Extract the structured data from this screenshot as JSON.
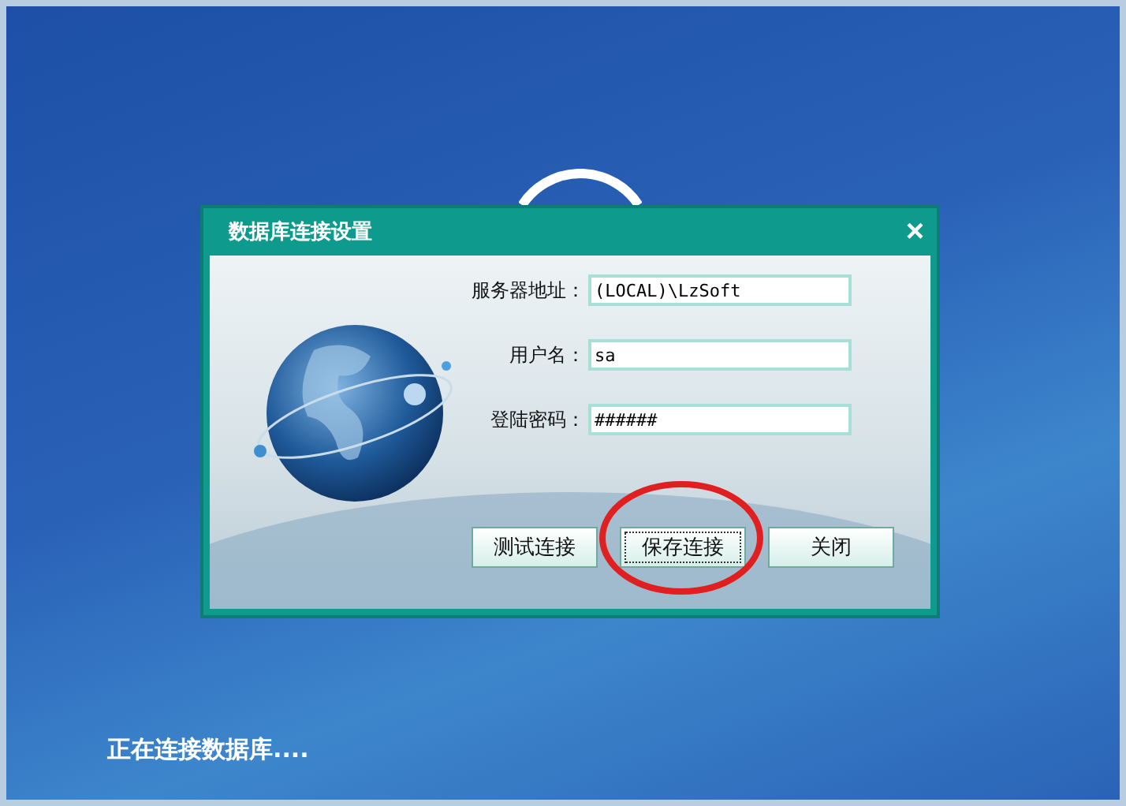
{
  "dialog": {
    "title": "数据库连接设置",
    "close": "×",
    "fields": [
      {
        "label": "服务器地址：",
        "value": "(LOCAL)\\LzSoft"
      },
      {
        "label": "用户名：",
        "value": "sa"
      },
      {
        "label": "登陆密码：",
        "value": "######"
      }
    ],
    "buttons": [
      {
        "label": "测试连接",
        "focused": false,
        "circled": false
      },
      {
        "label": "保存连接",
        "focused": true,
        "circled": true
      },
      {
        "label": "关闭",
        "focused": false,
        "circled": false
      }
    ]
  },
  "status": "正在连接数据库...."
}
